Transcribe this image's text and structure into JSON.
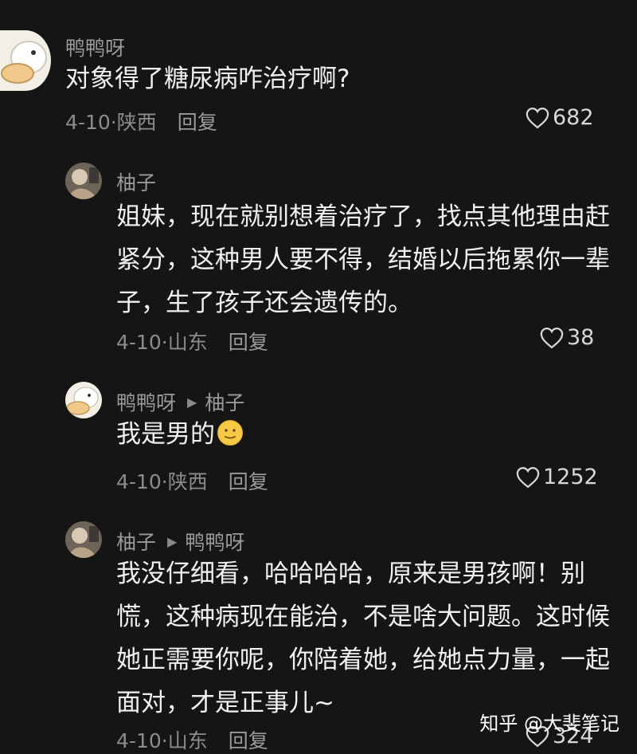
{
  "comments": [
    {
      "user": "鸭鸭呀",
      "reply_to": "",
      "text_lines": [
        "对象得了糖尿病咋治疗啊?"
      ],
      "date": "4-10",
      "region": "陕西",
      "reply_label": "回复",
      "likes": "682",
      "avatar_icon": "duck-avatar-icon"
    },
    {
      "user": "柚子",
      "reply_to": "",
      "text_lines": [
        "姐妹，现在就别想着治疗了，找点其他理由赶",
        "紧分，这种男人要不得，结婚以后拖累你一辈",
        "子，生了孩子还会遗传的。"
      ],
      "date": "4-10",
      "region": "山东",
      "reply_label": "回复",
      "likes": "38",
      "avatar_icon": "photo-avatar-icon"
    },
    {
      "user": "鸭鸭呀",
      "reply_to": "柚子",
      "text_lines": [
        "我是男的"
      ],
      "emoji": "smile-emoji",
      "date": "4-10",
      "region": "陕西",
      "reply_label": "回复",
      "likes": "1252",
      "avatar_icon": "duck-avatar-icon"
    },
    {
      "user": "柚子",
      "reply_to": "鸭鸭呀",
      "text_lines": [
        "我没仔细看，哈哈哈哈，原来是男孩啊！别",
        "慌，这种病现在能治，不是啥大问题。这时候",
        "她正需要你呢，你陪着她，给她点力量，一起",
        "面对，才是正事儿~"
      ],
      "date": "4-10",
      "region": "山东",
      "reply_label": "回复",
      "likes": "324",
      "avatar_icon": "photo-avatar-icon"
    }
  ],
  "meta_separator": "·",
  "watermark": "知乎 @大斐笔记",
  "colors": {
    "background": "#151515",
    "text": "#f0f0f0",
    "muted": "#8c8c8c",
    "emoji": "#f6c945"
  }
}
